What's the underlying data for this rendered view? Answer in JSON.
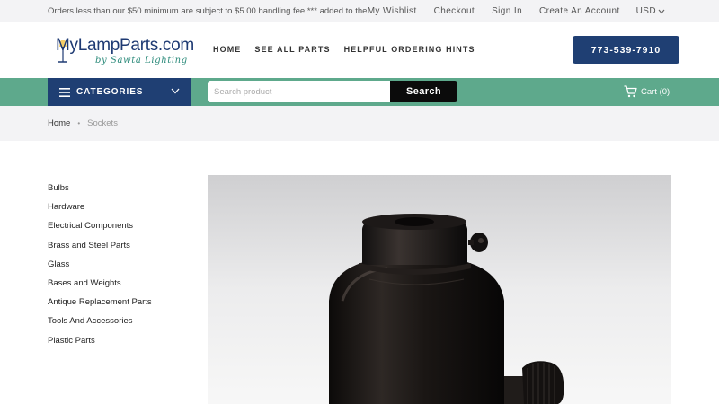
{
  "topbar": {
    "notice": "Orders less than our $50 minimum are subject to $5.00 handling fee *** added to the",
    "links": [
      "My Wishlist",
      "Checkout",
      "Sign In",
      "Create An Account"
    ],
    "currency": "USD"
  },
  "header": {
    "logo_text": "MyLampParts.com",
    "logo_tagline": "by Sawta Lighting",
    "nav": [
      "HOME",
      "SEE ALL PARTS",
      "HELPFUL ORDERING HINTS"
    ],
    "phone": "773-539-7910"
  },
  "navbar": {
    "categories_label": "CATEGORIES",
    "search_placeholder": "Search product",
    "search_button": "Search",
    "cart_label": "Cart (0)"
  },
  "breadcrumb": {
    "home": "Home",
    "current": "Sockets"
  },
  "sidebar": {
    "items": [
      "Bulbs",
      "Hardware",
      "Electrical Components",
      "Brass and Steel Parts",
      "Glass",
      "Bases and Weights",
      "Antique Replacement Parts",
      "Tools And Accessories",
      "Plastic Parts"
    ]
  },
  "colors": {
    "brand_navy": "#1f3f73",
    "nav_green": "#5ea98c",
    "topbar_bg": "#f3f3f5",
    "search_button_bg": "#0b0b0b"
  },
  "icons": {
    "menu": "hamburger-icon",
    "dropdown": "chevron-down-icon",
    "cart": "cart-icon"
  }
}
